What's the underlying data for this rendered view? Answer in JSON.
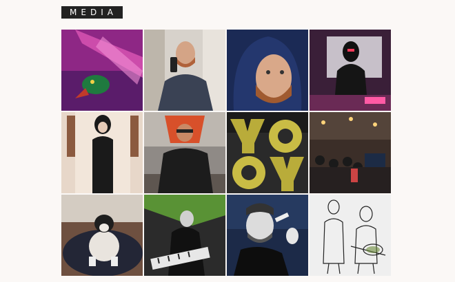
{
  "header": {
    "logo_text": "MEDIA"
  },
  "gallery": {
    "tiles": [
      {
        "icon": "pink-bird-image"
      },
      {
        "icon": "man-selfie-hoodie-image"
      },
      {
        "icon": "hooded-man-closeup-image"
      },
      {
        "icon": "hooded-dj-image"
      },
      {
        "icon": "person-in-doorway-image"
      },
      {
        "icon": "man-with-mask-image"
      },
      {
        "icon": "yo-yo-letters-image"
      },
      {
        "icon": "crowd-event-image"
      },
      {
        "icon": "dog-on-bed-image"
      },
      {
        "icon": "keyboard-player-image"
      },
      {
        "icon": "singer-microphone-image"
      },
      {
        "icon": "sketch-band-image"
      }
    ]
  },
  "colors": {
    "background": "#fbf8f6",
    "logo_bg": "#222222",
    "logo_text": "#ffffff"
  }
}
